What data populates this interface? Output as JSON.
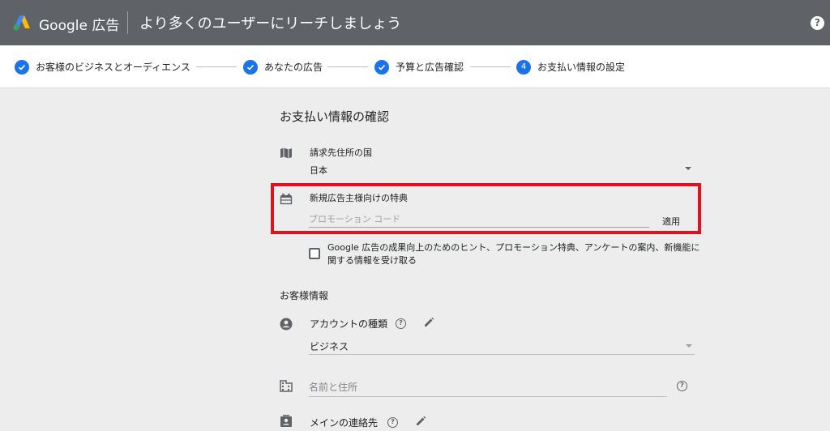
{
  "header": {
    "brand": "Google 広告",
    "title": "より多くのユーザーにリーチしましょう",
    "help_glyph": "?"
  },
  "stepper": {
    "steps": [
      {
        "label": "お客様のビジネスとオーディエンス",
        "state": "done"
      },
      {
        "label": "あなたの広告",
        "state": "done"
      },
      {
        "label": "予算と広告確認",
        "state": "done"
      },
      {
        "label": "お支払い情報の設定",
        "state": "current",
        "number": "4"
      }
    ]
  },
  "payment": {
    "section_title": "お支払い情報の確認",
    "billing_country": {
      "label": "請求先住所の国",
      "value": "日本",
      "icon": "map-icon"
    },
    "promo": {
      "label": "新規広告主様向けの特典",
      "placeholder": "プロモーション コード",
      "apply_label": "適用",
      "icon": "gift-icon",
      "highlight_color": "#e3101e"
    },
    "newsletter": {
      "label": "Google 広告の成果向上のためのヒント、プロモーション特典、アンケートの案内、新機能に関する情報を受け取る",
      "checked": false
    }
  },
  "customer": {
    "section_title": "お客様情報",
    "account_type": {
      "label": "アカウントの種類",
      "value": "ビジネス",
      "icon": "account-circle-icon"
    },
    "name_address": {
      "placeholder": "名前と住所",
      "icon": "business-icon"
    },
    "main_contact": {
      "label": "メインの連絡先",
      "icon": "contact-card-icon"
    }
  },
  "colors": {
    "header_bg": "#5f6368",
    "accent": "#1a73e8",
    "highlight": "#e3101e"
  }
}
